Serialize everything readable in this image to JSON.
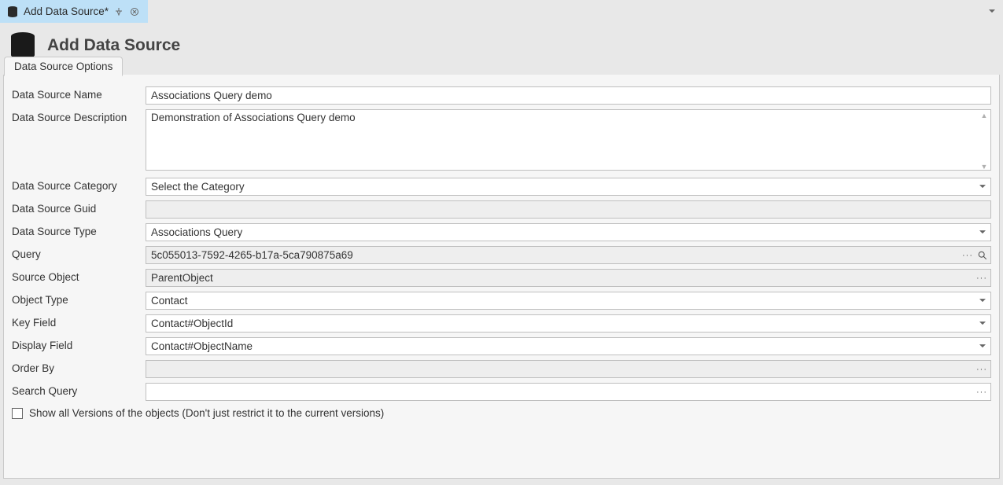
{
  "tabstrip": {
    "tab_title": "Add Data Source*"
  },
  "header": {
    "title": "Add Data Source"
  },
  "form": {
    "tab": "Data Source Options",
    "labels": {
      "name": "Data Source Name",
      "description": "Data Source Description",
      "category": "Data Source Category",
      "guid": "Data Source Guid",
      "type": "Data Source Type",
      "query": "Query",
      "source_object": "Source Object",
      "object_type": "Object Type",
      "key_field": "Key Field",
      "display_field": "Display Field",
      "order_by": "Order By",
      "search_query": "Search Query",
      "show_all_versions": "Show all Versions of the objects (Don't just restrict it to the current versions)"
    },
    "values": {
      "name": "Associations Query demo",
      "description": "Demonstration of Associations Query demo",
      "category": "Select the Category",
      "guid": "",
      "type": "Associations Query",
      "query": "5c055013-7592-4265-b17a-5ca790875a69",
      "source_object": "ParentObject",
      "object_type": "Contact",
      "key_field": "Contact#ObjectId",
      "display_field": "Contact#ObjectName",
      "order_by": "",
      "search_query": "",
      "show_all_versions_checked": false
    }
  }
}
